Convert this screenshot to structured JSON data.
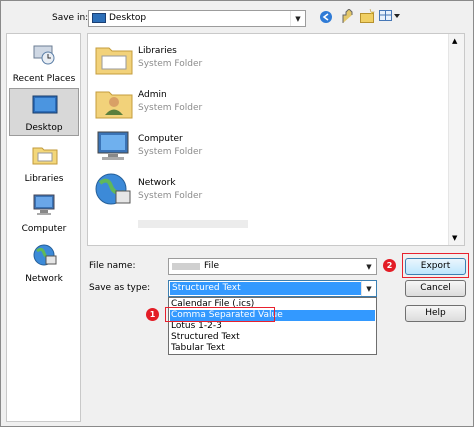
{
  "save_in": {
    "label": "Save in:",
    "value": "Desktop"
  },
  "places": [
    {
      "label": "Recent Places"
    },
    {
      "label": "Desktop"
    },
    {
      "label": "Libraries"
    },
    {
      "label": "Computer"
    },
    {
      "label": "Network"
    }
  ],
  "files": [
    {
      "name": "Libraries",
      "type": "System Folder"
    },
    {
      "name": "Admin",
      "type": "System Folder"
    },
    {
      "name": "Computer",
      "type": "System Folder"
    },
    {
      "name": "Network",
      "type": "System Folder"
    }
  ],
  "file_name": {
    "label": "File name:",
    "value": "File"
  },
  "save_as_type": {
    "label": "Save as type:",
    "value": "Structured Text",
    "options": [
      "Calendar File (.ics)",
      "Comma Separated Value",
      "Lotus 1-2-3",
      "Structured Text",
      "Tabular Text"
    ]
  },
  "buttons": {
    "export": "Export",
    "cancel": "Cancel",
    "help": "Help"
  },
  "callouts": {
    "one": "1",
    "two": "2"
  },
  "colors": {
    "callout_red": "#e8212e",
    "selection": "#3399ff"
  }
}
